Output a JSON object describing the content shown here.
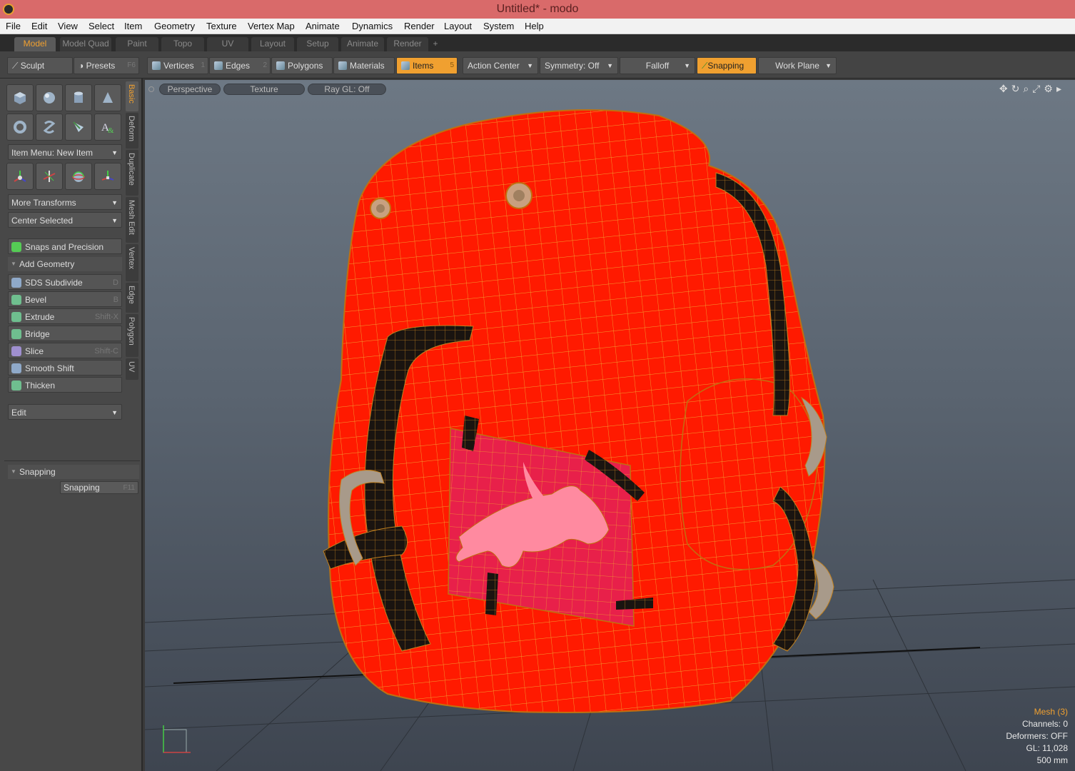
{
  "window": {
    "title": "Untitled* - modo"
  },
  "menu": [
    "File",
    "Edit",
    "View",
    "Select",
    "Item",
    "Geometry",
    "Texture",
    "Vertex Map",
    "Animate",
    "Dynamics",
    "Render",
    "Layout",
    "System",
    "Help"
  ],
  "layout_tabs": [
    "Model",
    "Model Quad",
    "Paint",
    "Topo",
    "UV",
    "Layout",
    "Setup",
    "Animate",
    "Render",
    "+"
  ],
  "toolbar": {
    "sculpt": "Sculpt",
    "presets": "Presets",
    "presets_key": "F6",
    "vertices": "Vertices",
    "vertices_key": "1",
    "edges": "Edges",
    "edges_key": "2",
    "polygons": "Polygons",
    "materials": "Materials",
    "items": "Items",
    "items_key": "5",
    "action_center": "Action Center",
    "symmetry": "Symmetry: Off",
    "falloff": "Falloff",
    "snapping": "Snapping",
    "work_plane": "Work Plane"
  },
  "side_tabs": [
    "Basic",
    "Deform",
    "Duplicate",
    "Mesh Edit",
    "Vertex",
    "Edge",
    "Polygon",
    "UV"
  ],
  "left_panel": {
    "item_menu": "Item Menu: New Item",
    "more_transforms": "More Transforms",
    "center_selected": "Center Selected",
    "snaps_precision": "Snaps and Precision",
    "add_geometry": "Add Geometry",
    "tools": [
      {
        "label": "SDS Subdivide",
        "key": "D",
        "icon": "sds-subdivide-icon",
        "color": "#8fa9c9"
      },
      {
        "label": "Bevel",
        "key": "B",
        "icon": "bevel-icon",
        "color": "#6fbf8f"
      },
      {
        "label": "Extrude",
        "key": "Shift-X",
        "icon": "extrude-icon",
        "color": "#6fbf8f"
      },
      {
        "label": "Bridge",
        "key": "",
        "icon": "bridge-icon",
        "color": "#6fbf8f"
      },
      {
        "label": "Slice",
        "key": "Shift-C",
        "icon": "slice-icon",
        "color": "#9f8fcf"
      },
      {
        "label": "Smooth Shift",
        "key": "",
        "icon": "smooth-shift-icon",
        "color": "#8fa9c9"
      },
      {
        "label": "Thicken",
        "key": "",
        "icon": "thicken-icon",
        "color": "#6fbf8f"
      }
    ],
    "edit": "Edit",
    "snapping_header": "Snapping",
    "snapping_button": "Snapping",
    "snapping_key": "F11"
  },
  "viewport": {
    "perspective": "Perspective",
    "texture": "Texture",
    "raygl": "Ray GL: Off",
    "stats": {
      "mesh": "Mesh (3)",
      "channels": "Channels: 0",
      "deformers": "Deformers: OFF",
      "gl": "GL: 11,028",
      "scale": "500 mm"
    }
  },
  "colors": {
    "accent": "#f0a030",
    "mesh_red": "#ff1a00",
    "wire": "#f0a030",
    "strap": "#1a1410"
  }
}
